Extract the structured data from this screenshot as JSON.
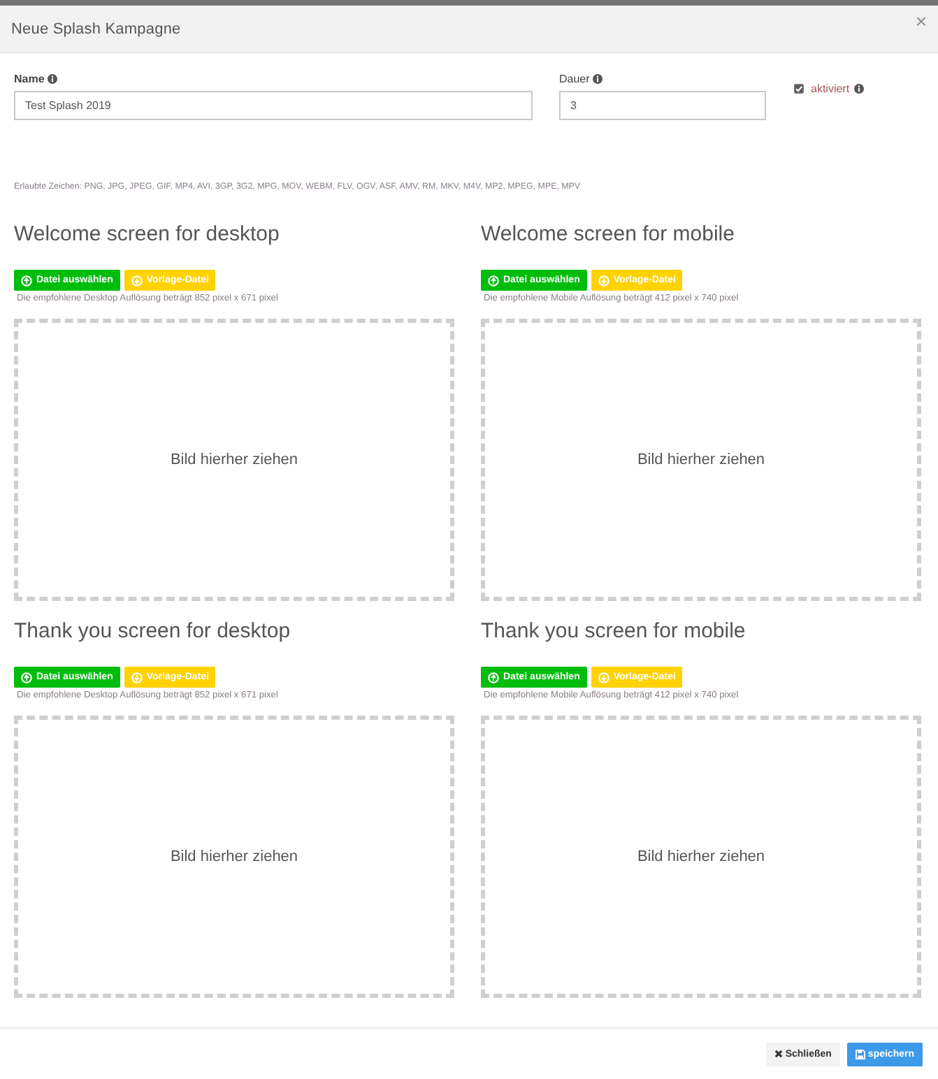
{
  "window": {
    "title": "Neue Splash Kampagne",
    "close": "×"
  },
  "form": {
    "name": {
      "label": "Name",
      "value": "Test Splash 2019"
    },
    "duration": {
      "label": "Dauer",
      "value": "3"
    },
    "active": {
      "label": "aktiviert",
      "checked": true
    }
  },
  "allowed_formats": "Erlaubte Zeichen: PNG, JPG, JPEG, GIF, MP4, AVI, 3GP, 3G2, MPG, MOV, WEBM, FLV, OGV, ASF, AMV, RM, MKV, M4V, MP2, MPEG, MPE, MPV",
  "screens": [
    {
      "title": "Welcome screen for desktop",
      "upload_button": "Datei auswählen",
      "template_button": "Vorlage-Datei",
      "hint": "Die empfohlene Desktop Auflösung beträgt 852 pixel x 671 pixel",
      "dropzone": "Bild hierher ziehen"
    },
    {
      "title": "Welcome screen for mobile",
      "upload_button": "Datei auswählen",
      "template_button": "Vorlage-Datei",
      "hint": "Die empfohlene Mobile Auflösung beträgt 412 pixel x 740 pixel",
      "dropzone": "Bild hierher ziehen"
    },
    {
      "title": "Thank you screen for desktop",
      "upload_button": "Datei auswählen",
      "template_button": "Vorlage-Datei",
      "hint": "Die empfohlene Desktop Auflösung beträgt 852 pixel x 671 pixel",
      "dropzone": "Bild hierher ziehen"
    },
    {
      "title": "Thank you screen for mobile",
      "upload_button": "Datei auswählen",
      "template_button": "Vorlage-Datei",
      "hint": "Die empfohlene Mobile Auflösung beträgt 412 pixel x 740 pixel",
      "dropzone": "Bild hierher ziehen"
    }
  ],
  "footer": {
    "buttons": [
      {
        "label": "Schließen",
        "kind": "close"
      },
      {
        "label": "speichern",
        "kind": "save"
      }
    ]
  }
}
